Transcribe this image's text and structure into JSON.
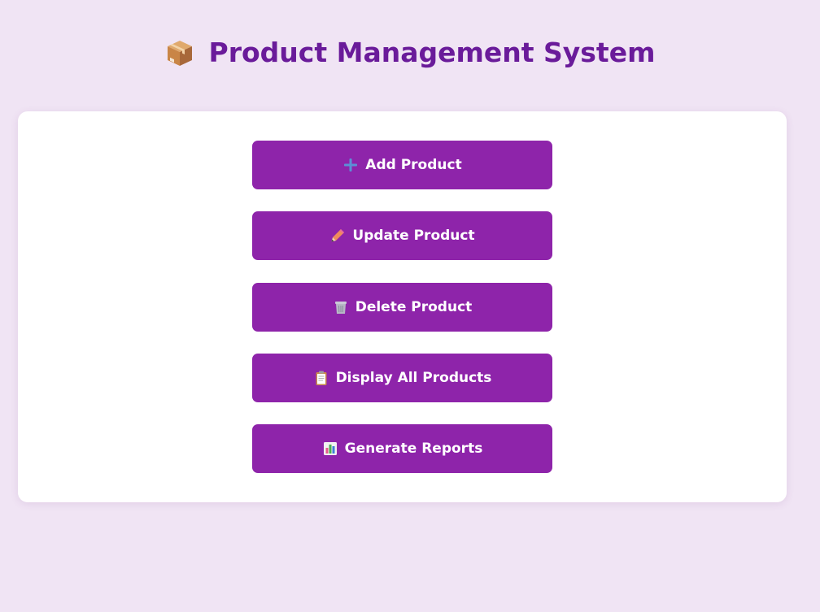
{
  "header": {
    "title": "Product Management System",
    "icon": "package-box-icon"
  },
  "menu": {
    "buttons": [
      {
        "label": "Add Product",
        "icon": "plus-icon"
      },
      {
        "label": "Update Product",
        "icon": "pencil-icon"
      },
      {
        "label": "Delete Product",
        "icon": "trash-icon"
      },
      {
        "label": "Display All Products",
        "icon": "clipboard-icon"
      },
      {
        "label": "Generate Reports",
        "icon": "bar-chart-icon"
      }
    ]
  },
  "colors": {
    "background": "#f0e4f4",
    "title": "#6a1b9a",
    "button": "#8e24aa",
    "button_text": "#ffffff",
    "card": "#ffffff"
  }
}
